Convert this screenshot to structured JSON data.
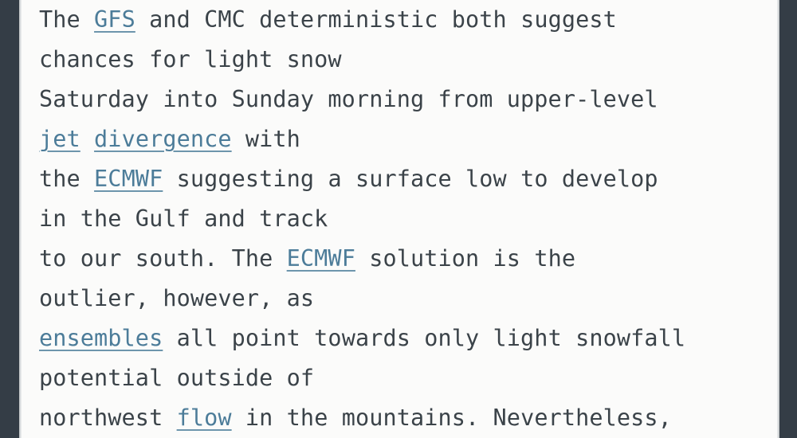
{
  "theme": {
    "page_background": "#343d46",
    "content_background": "#fbfbfa",
    "text_color": "#3b4349",
    "link_color": "#4c7c99",
    "divider_color": "#c3c7ca"
  },
  "document": {
    "type": "forecast-discussion-excerpt",
    "font_style": "monospace",
    "lines": [
      {
        "id": "line-1",
        "segments": [
          {
            "text": "The ",
            "link": false
          },
          {
            "text": "GFS",
            "link": true
          },
          {
            "text": " and CMC deterministic both suggest",
            "link": false
          }
        ],
        "plain": "The GFS and CMC deterministic both suggest"
      },
      {
        "id": "line-2",
        "segments": [
          {
            "text": "chances for light snow",
            "link": false
          }
        ],
        "plain": "chances for light snow"
      },
      {
        "id": "line-3",
        "segments": [
          {
            "text": "Saturday into Sunday morning from upper-level",
            "link": false
          }
        ],
        "plain": "Saturday into Sunday morning from upper-level"
      },
      {
        "id": "line-4",
        "segments": [
          {
            "text": "jet",
            "link": true
          },
          {
            "text": " ",
            "link": false
          },
          {
            "text": "divergence",
            "link": true
          },
          {
            "text": " with",
            "link": false
          }
        ],
        "plain": "jet divergence with"
      },
      {
        "id": "line-5",
        "segments": [
          {
            "text": "the ",
            "link": false
          },
          {
            "text": "ECMWF",
            "link": true
          },
          {
            "text": " suggesting a surface low to develop",
            "link": false
          }
        ],
        "plain": "the ECMWF suggesting a surface low to develop"
      },
      {
        "id": "line-6",
        "segments": [
          {
            "text": "in the Gulf and track",
            "link": false
          }
        ],
        "plain": "in the Gulf and track"
      },
      {
        "id": "line-7",
        "segments": [
          {
            "text": "to our south. The ",
            "link": false
          },
          {
            "text": "ECMWF",
            "link": true
          },
          {
            "text": " solution is the",
            "link": false
          }
        ],
        "plain": "to our south. The ECMWF solution is the"
      },
      {
        "id": "line-8",
        "segments": [
          {
            "text": "outlier, however, as",
            "link": false
          }
        ],
        "plain": "outlier, however, as"
      },
      {
        "id": "line-9",
        "segments": [
          {
            "text": "ensembles",
            "link": true
          },
          {
            "text": " all point towards only light snowfall",
            "link": false
          }
        ],
        "plain": "ensembles all point towards only light snowfall"
      },
      {
        "id": "line-10",
        "segments": [
          {
            "text": "potential outside of",
            "link": false
          }
        ],
        "plain": "potential outside of"
      },
      {
        "id": "line-11",
        "segments": [
          {
            "text": "northwest ",
            "link": false
          },
          {
            "text": "flow",
            "link": true
          },
          {
            "text": " in the mountains. Nevertheless,",
            "link": false
          }
        ],
        "plain": "northwest flow in the mountains. Nevertheless,"
      }
    ],
    "links": [
      "GFS",
      "jet",
      "divergence",
      "ECMWF",
      "ECMWF",
      "ensembles",
      "flow"
    ]
  }
}
